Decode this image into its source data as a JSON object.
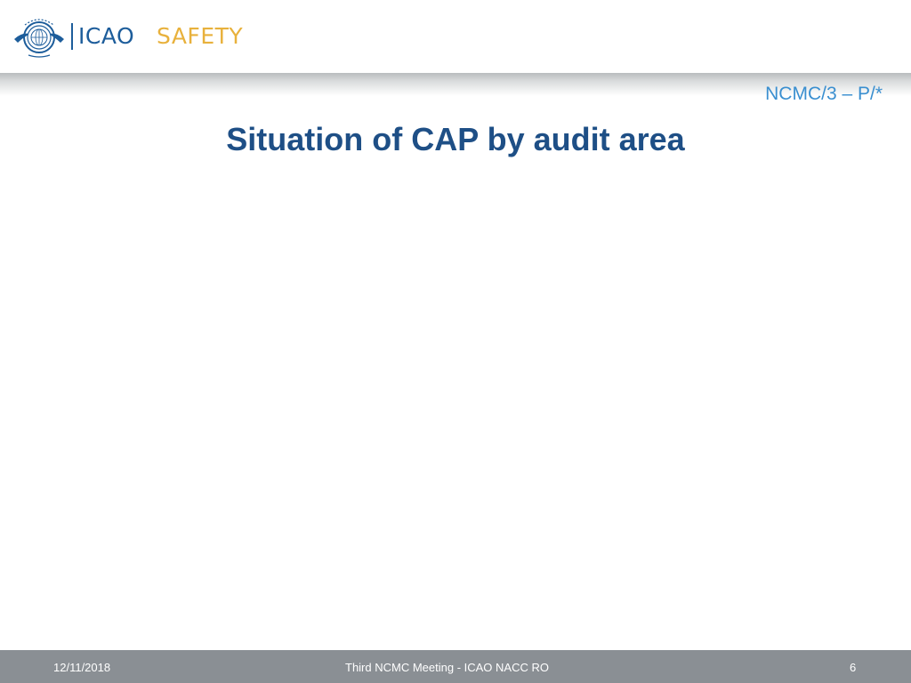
{
  "header": {
    "brand_icao": "ICAO",
    "brand_safety": "SAFETY",
    "emblem_icon": "icao-emblem-icon",
    "ref_code": "NCMC/3 – P/*"
  },
  "slide": {
    "title": "Situation of CAP by audit area"
  },
  "footer": {
    "date": "12/11/2018",
    "center": "Third NCMC Meeting - ICAO NACC RO",
    "page": "6"
  },
  "colors": {
    "brand_blue": "#1d5d9b",
    "brand_gold": "#e8b13c",
    "title_blue": "#1e4f86",
    "ref_blue": "#3a8fd0",
    "footer_gray": "#8a8f94"
  }
}
